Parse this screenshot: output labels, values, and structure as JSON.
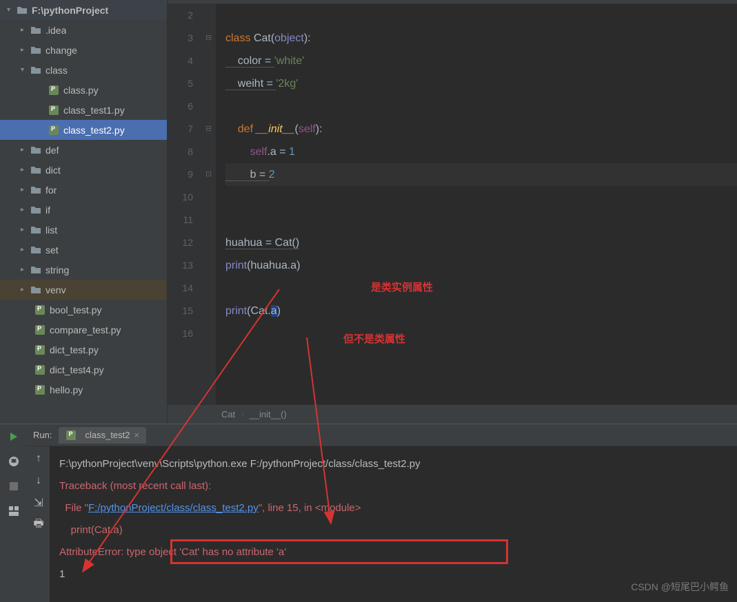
{
  "project_root": "F:\\pythonProject",
  "tree": {
    "idea": ".idea",
    "change": "change",
    "class": "class",
    "class_py": "class.py",
    "class_test1": "class_test1.py",
    "class_test2": "class_test2.py",
    "def": "def",
    "dict": "dict",
    "for": "for",
    "if": "if",
    "list": "list",
    "set": "set",
    "string": "string",
    "venv": "venv",
    "bool_test": "bool_test.py",
    "compare_test": "compare_test.py",
    "dict_test": "dict_test.py",
    "dict_test4": "dict_test4.py",
    "hello": "hello.py"
  },
  "gutter": [
    "2",
    "3",
    "4",
    "5",
    "6",
    "7",
    "8",
    "9",
    "10",
    "11",
    "12",
    "13",
    "14",
    "15",
    "16"
  ],
  "code": {
    "l3_kw": "class ",
    "l3_name": "Cat",
    "l3_paren": "(",
    "l3_obj": "object",
    "l3_end": "):",
    "l4": "    color = ",
    "l4_str": "'white'",
    "l5": "    weiht = ",
    "l5_str": "'2kg'",
    "l7": "    def ",
    "l7_fn": "__init__",
    "l7_args": "(",
    "l7_self": "self",
    "l7_end": "):",
    "l8_self": "        self",
    "l8_rest": ".a = ",
    "l8_num": "1",
    "l9": "        b = ",
    "l9_num": "2",
    "l12": "huahua = Cat()",
    "l13": "print",
    "l13_rest": "(huahua.a)",
    "l15": "print",
    "l15_rest": "(Cat.",
    "l15_a": "a",
    "l15_end": ")"
  },
  "annot1": "是类实例属性",
  "annot2": "但不是类属性",
  "breadcrumb": {
    "b1": "Cat",
    "b2": "__init__()"
  },
  "run": {
    "label": "Run:",
    "tab": "class_test2",
    "exe_line": "F:\\pythonProject\\venv\\Scripts\\python.exe F:/pythonProject/class/class_test2.py",
    "tb1": "Traceback (most recent call last):",
    "tb2_a": "  File \"",
    "tb2_link": "F:/pythonProject/class/class_test2.py",
    "tb2_b": "\", line 15, in <module>",
    "tb3": "    print(Cat.a)",
    "tb4_a": "AttributeError: ",
    "tb4_b": "type object 'Cat' has no attribute 'a'",
    "out1": "1"
  },
  "watermark": "CSDN @短尾巴小鳄鱼"
}
